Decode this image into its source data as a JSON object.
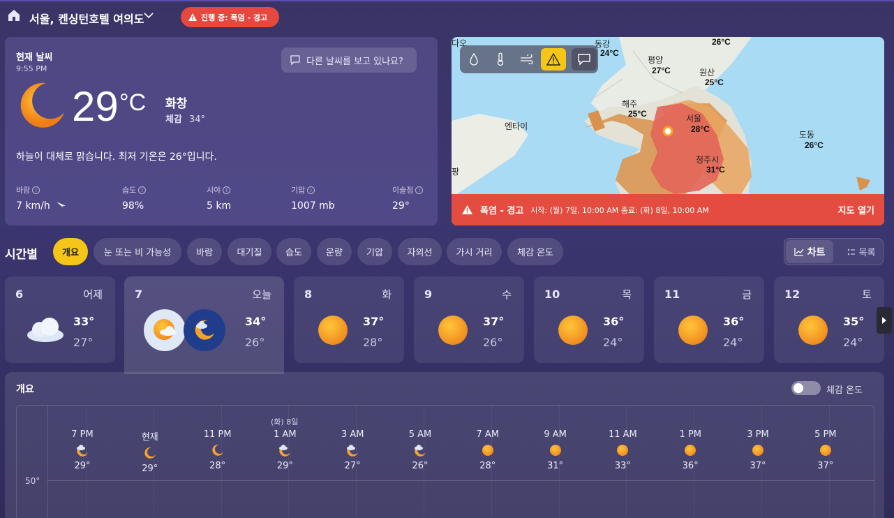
{
  "header": {
    "location": "서울, 켄싱턴호텔 여의도",
    "alert_label": "진행 중: 폭염 - 경고"
  },
  "current": {
    "title": "현재 날씨",
    "time": "9:55 PM",
    "other_weather": "다른 날씨를 보고 있나요?",
    "temp": "29",
    "unit": "°C",
    "condition": "화창",
    "feels_label": "체감",
    "feels_value": "34°",
    "summary": "하늘이 대체로 맑습니다. 최저 기온은 26°입니다.",
    "stats": [
      {
        "label": "바람",
        "value": "7 km/h"
      },
      {
        "label": "습도",
        "value": "98%"
      },
      {
        "label": "시야",
        "value": "5 km"
      },
      {
        "label": "기압",
        "value": "1007 mb"
      },
      {
        "label": "이슬점",
        "value": "29°"
      }
    ]
  },
  "map": {
    "alert_title": "폭염 - 경고",
    "alert_range": "시작: (월) 7일, 10:00 AM 종료: (화) 8일, 10:00 AM",
    "open_map": "지도 열기",
    "places": [
      {
        "name": "동강",
        "temp": "24°C"
      },
      {
        "name": "평양",
        "temp": "27°C"
      },
      {
        "name": "원산",
        "temp": "25°C"
      },
      {
        "name": "해주",
        "temp": "25°C"
      },
      {
        "name": "서울",
        "temp": "28°C"
      },
      {
        "name": "청주시",
        "temp": "31°C"
      },
      {
        "name": "도동",
        "temp": "26°C"
      },
      {
        "name": "엔타이",
        "temp": ""
      }
    ],
    "partial_labels": [
      "다오",
      "26°C",
      "팡"
    ]
  },
  "hourly": {
    "title": "시간별",
    "chips": [
      "개요",
      "눈 또는 비 가능성",
      "바람",
      "대기질",
      "습도",
      "운량",
      "기압",
      "자외선",
      "가시 거리",
      "체감 온도"
    ],
    "view_chart": "차트",
    "view_list": "목록"
  },
  "days": [
    {
      "num": "6",
      "name": "어제",
      "hi": "33°",
      "lo": "27°"
    },
    {
      "num": "7",
      "name": "오늘",
      "hi": "34°",
      "lo": "26°"
    },
    {
      "num": "8",
      "name": "화",
      "hi": "37°",
      "lo": "28°"
    },
    {
      "num": "9",
      "name": "수",
      "hi": "37°",
      "lo": "26°"
    },
    {
      "num": "10",
      "name": "목",
      "hi": "36°",
      "lo": "24°"
    },
    {
      "num": "11",
      "name": "금",
      "hi": "36°",
      "lo": "24°"
    },
    {
      "num": "12",
      "name": "토",
      "hi": "35°",
      "lo": "24°"
    }
  ],
  "overview": {
    "title": "개요",
    "toggle_label": "체감 온도",
    "y_label": "50°",
    "date_marker": "(화) 8일",
    "hours": [
      {
        "time": "7 PM",
        "temp": "29°",
        "icon": "moon-cloud"
      },
      {
        "time": "현재",
        "temp": "29°",
        "icon": "moon"
      },
      {
        "time": "11 PM",
        "temp": "28°",
        "icon": "moon"
      },
      {
        "time": "1 AM",
        "temp": "29°",
        "icon": "moon-cloud"
      },
      {
        "time": "3 AM",
        "temp": "27°",
        "icon": "moon-cloud"
      },
      {
        "time": "5 AM",
        "temp": "26°",
        "icon": "moon-cloud"
      },
      {
        "time": "7 AM",
        "temp": "28°",
        "icon": "sun"
      },
      {
        "time": "9 AM",
        "temp": "31°",
        "icon": "sun"
      },
      {
        "time": "11 AM",
        "temp": "33°",
        "icon": "sun"
      },
      {
        "time": "1 PM",
        "temp": "36°",
        "icon": "sun"
      },
      {
        "time": "3 PM",
        "temp": "37°",
        "icon": "sun"
      },
      {
        "time": "5 PM",
        "temp": "37°",
        "icon": "sun"
      }
    ]
  }
}
